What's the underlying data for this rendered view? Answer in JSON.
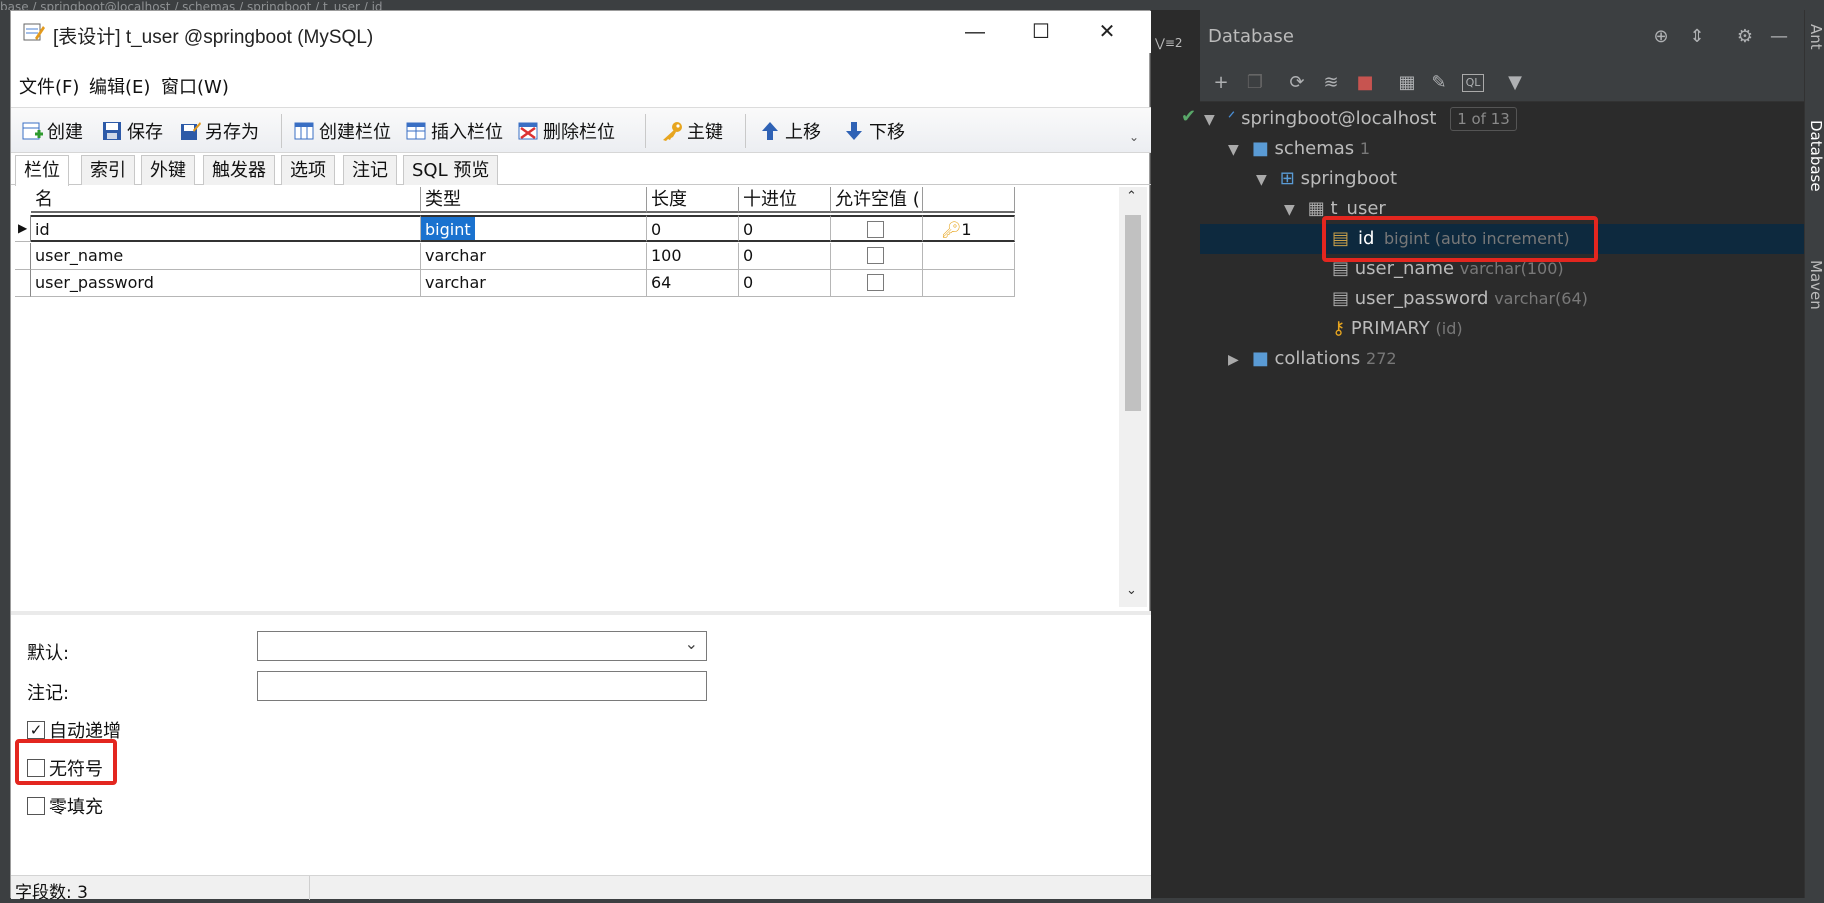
{
  "ide_top_crumbs": "base  /  springboot@localhost  /  schemas  /  springboot  /  t_user  /  id",
  "window": {
    "title": "[表设计] t_user @springboot (MySQL)",
    "minimize": "—",
    "maximize": "☐",
    "close": "✕"
  },
  "menu": [
    "文件(F)",
    "编辑(E)",
    "窗口(W)"
  ],
  "toolbar": {
    "create": "创建",
    "save": "保存",
    "save_as": "另存为",
    "create_column": "创建栏位",
    "insert_column": "插入栏位",
    "delete_column": "删除栏位",
    "primary_key": "主键",
    "move_up": "上移",
    "move_down": "下移"
  },
  "tabs": [
    "栏位",
    "索引",
    "外键",
    "触发器",
    "选项",
    "注记",
    "SQL 预览"
  ],
  "grid": {
    "headers": [
      "名",
      "类型",
      "长度",
      "十进位",
      "允许空值 ("
    ],
    "rows": [
      {
        "name": "id",
        "type": "bigint",
        "length": "0",
        "decimal": "0",
        "nullable": false,
        "key": "1"
      },
      {
        "name": "user_name",
        "type": "varchar",
        "length": "100",
        "decimal": "0",
        "nullable": false,
        "key": ""
      },
      {
        "name": "user_password",
        "type": "varchar",
        "length": "64",
        "decimal": "0",
        "nullable": false,
        "key": ""
      }
    ]
  },
  "props": {
    "default_label": "默认:",
    "comment_label": "注记:",
    "auto_increment_label": "自动递增",
    "auto_increment_checked": true,
    "unsigned_label": "无符号",
    "unsigned_checked": false,
    "zerofill_label": "零填充",
    "zerofill_checked": false
  },
  "status": {
    "field_count": "字段数: 3"
  },
  "database_panel": {
    "title": "Database",
    "tree": {
      "root": "springboot@localhost",
      "root_badge": "1 of 13",
      "schemas": "schemas",
      "schemas_count": "1",
      "schema": "springboot",
      "table": "t_user",
      "columns": [
        {
          "name": "id",
          "type": "bigint (auto increment)"
        },
        {
          "name": "user_name",
          "type": "varchar(100)"
        },
        {
          "name": "user_password",
          "type": "varchar(64)"
        }
      ],
      "key": "PRIMARY",
      "key_cols": "(id)",
      "collations": "collations",
      "collations_count": "272"
    },
    "side_labels": [
      "Ant",
      "Database",
      "Maven"
    ]
  },
  "colors": {
    "highlight": "#e3261f",
    "selection": "#1a72cf",
    "ide_bg": "#2b2b2b"
  }
}
